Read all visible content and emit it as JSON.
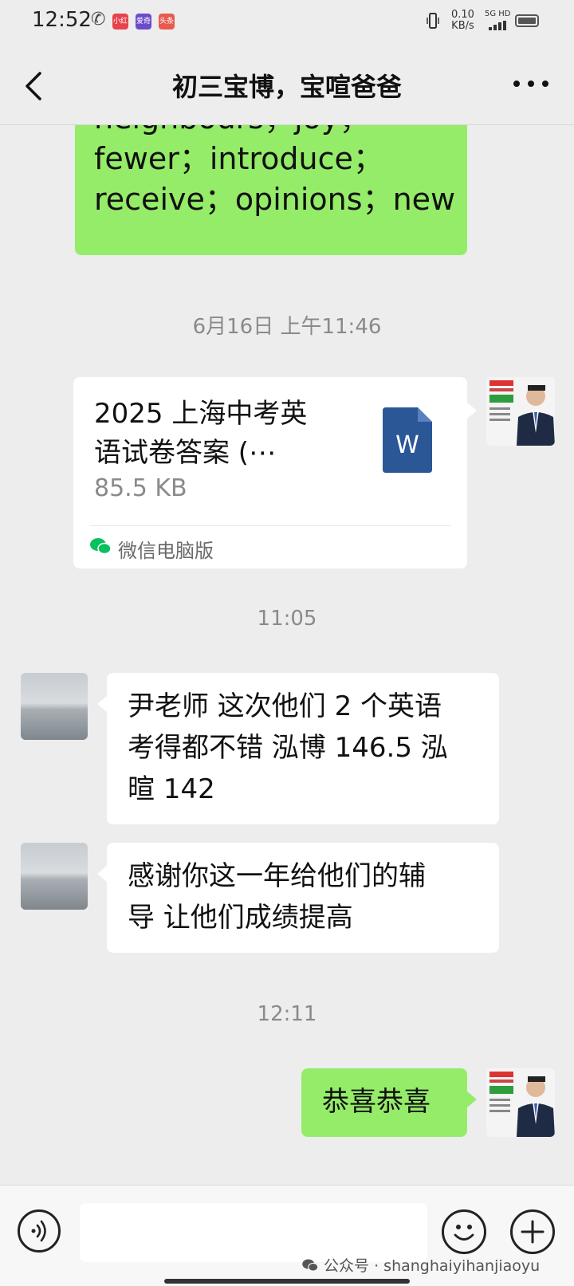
{
  "status_bar": {
    "time": "12:52",
    "network_speed": "0.10",
    "network_unit": "KB/s",
    "signal_label": "5G HD",
    "app_badges": [
      {
        "label": "小红书",
        "color": "#e8424a"
      },
      {
        "label": "爱奇",
        "color": "#6b4bcc"
      },
      {
        "label": "头条",
        "color": "#e85a4f"
      }
    ]
  },
  "header": {
    "title": "初三宝博，宝喧爸爸"
  },
  "messages": {
    "top_partial_text": "neighbours；joy；\nfewer；introduce；\nreceive；opinions；new",
    "timestamp_1": "6月16日 上午11:46",
    "file_card": {
      "name": "2025 上海中考英\n语试卷答案 (⋯",
      "size": "85.5 KB",
      "source": "微信电脑版",
      "file_type": "W"
    },
    "timestamp_2": "11:05",
    "incoming_1": "尹老师 这次他们 2 个英语\n考得都不错 泓博 146.5 泓\n暄 142",
    "incoming_2": "感谢你这一年给他们的辅\n导 让他们成绩提高",
    "timestamp_3": "12:11",
    "outgoing_1": "恭喜恭喜"
  },
  "watermark": "公众号 · shanghaiyihanjiaoyu",
  "colors": {
    "background": "#ededed",
    "outgoing_bubble": "#95ec69",
    "incoming_bubble": "#ffffff",
    "word_icon": "#2b5797",
    "wechat_green": "#07c160"
  }
}
